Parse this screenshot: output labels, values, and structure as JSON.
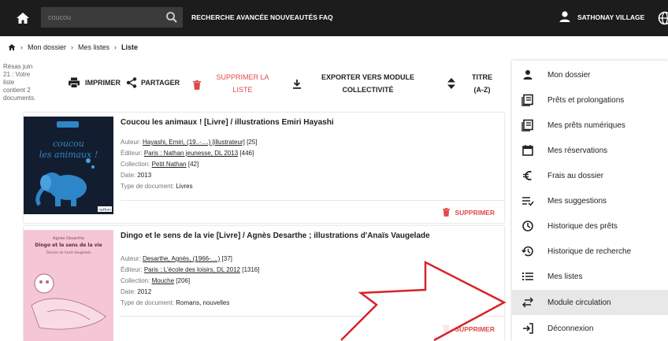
{
  "topbar": {
    "search_value": "coucou",
    "nav": [
      "RECHERCHE AVANCÉE",
      "NOUVEAUTÉS",
      "FAQ"
    ],
    "user": "SATHONAY VILLAGE",
    "background": "#1c1c1c"
  },
  "breadcrumb": [
    "Mon dossier",
    "Mes listes",
    "Liste"
  ],
  "toolbar": {
    "results": [
      "Résas juin",
      "21 : Votre",
      "liste",
      "contient 2",
      "documents."
    ],
    "print": "IMPRIMER",
    "share": "PARTAGER",
    "delete_list": [
      "SUPPRIMER LA",
      "LISTE"
    ],
    "export": [
      "EXPORTER VERS MODULE",
      "COLLECTIVITÉ"
    ],
    "sort": [
      "TITRE",
      "(A-Z)"
    ]
  },
  "labels": {
    "author": "Auteur:",
    "publisher": "Éditeur:",
    "collection": "Collection:",
    "date": "Date:",
    "doctype": "Type de document:",
    "delete": "SUPPRIMER"
  },
  "records": [
    {
      "title": "Coucou les animaux ! [Livre] / illustrations Emiri Hayashi",
      "author": "Hayashi, Emiri, (19..-....) [illustrateur]",
      "author_count": "[25]",
      "publisher": "Paris : Nathan jeunesse, DL 2013",
      "publisher_count": "[446]",
      "collection": "Petit Nathan",
      "collection_count": "[42]",
      "date": "2013",
      "doctype": "Livres",
      "cover_title": [
        "coucou",
        "les animaux !"
      ],
      "cover_publisher": "nathan"
    },
    {
      "title": "Dingo et le sens de la vie [Livre] / Agnès Desarthe ; illustrations d'Anaïs Vaugelade",
      "author": "Desarthe, Agnès, (1966-....)",
      "author_count": "[37]",
      "publisher": "Paris : L'école des loisirs, DL 2012",
      "publisher_count": "[1316]",
      "collection": "Mouche",
      "collection_count": "[206]",
      "date": "2012",
      "doctype": "Romans, nouvelles",
      "cover_author": "Agnès Desarthe",
      "cover_title": "Dingo et le sens de la vie",
      "cover_illustrator": "Dessins de Anaïs Vaugelade"
    }
  ],
  "side_menu": [
    {
      "label": "Mon dossier",
      "icon": "user-icon"
    },
    {
      "label": "Prêts et prolongations",
      "icon": "book-icon"
    },
    {
      "label": "Mes prêts numériques",
      "icon": "book-icon"
    },
    {
      "label": "Mes réservations",
      "icon": "calendar-icon"
    },
    {
      "label": "Frais au dossier",
      "icon": "euro-icon"
    },
    {
      "label": "Mes suggestions",
      "icon": "playlist-add-icon"
    },
    {
      "label": "Historique des prêts",
      "icon": "clock-icon"
    },
    {
      "label": "Historique de recherche",
      "icon": "history-icon"
    },
    {
      "label": "Mes listes",
      "icon": "list-icon"
    },
    {
      "label": "Module circulation",
      "icon": "swap-arrows-icon",
      "active": true
    },
    {
      "label": "Déconnexion",
      "icon": "logout-icon"
    }
  ],
  "colors": {
    "accent_red": "#e04949",
    "active_menu": "#e8e8e8",
    "arrow_outline": "#d9232a",
    "cover1_bg": "#121e30",
    "cover1_elephant": "#2d86c7",
    "cover2_bg": "#f4c6d6"
  }
}
